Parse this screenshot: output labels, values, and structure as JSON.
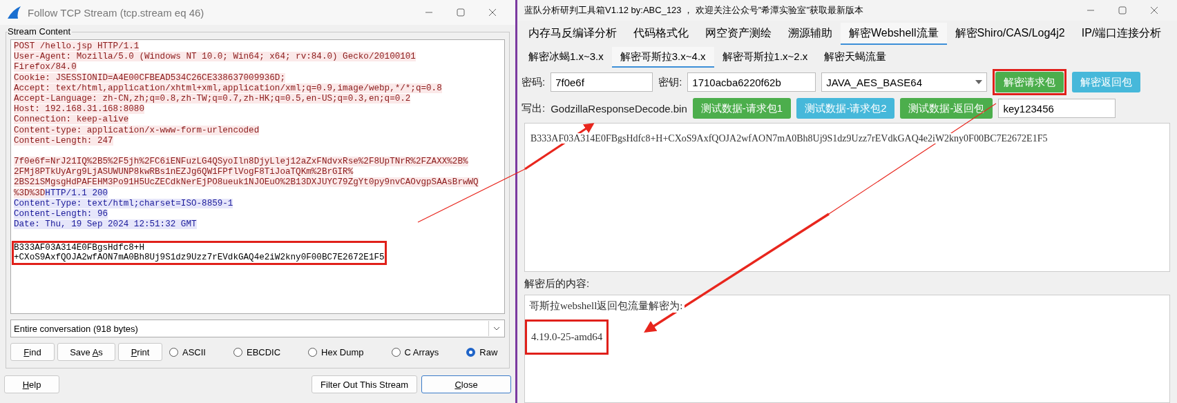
{
  "left_window": {
    "title": "Follow TCP Stream (tcp.stream eq 46)",
    "group_label": "Stream Content",
    "stream_lines": [
      {
        "kind": "client",
        "text": "POST /hello.jsp HTTP/1.1"
      },
      {
        "kind": "client",
        "text": "User-Agent: Mozilla/5.0 (Windows NT 10.0; Win64; x64; rv:84.0) Gecko/20100101"
      },
      {
        "kind": "client",
        "text": "Firefox/84.0"
      },
      {
        "kind": "client",
        "text": "Cookie: JSESSIONID=A4E00CFBEAD534C26CE338637009936D;"
      },
      {
        "kind": "client",
        "text": "Accept: text/html,application/xhtml+xml,application/xml;q=0.9,image/webp,*/*;q=0.8"
      },
      {
        "kind": "client",
        "text": "Accept-Language: zh-CN,zh;q=0.8,zh-TW;q=0.7,zh-HK;q=0.5,en-US;q=0.3,en;q=0.2"
      },
      {
        "kind": "client",
        "text": "Host: 192.168.31.168:8080"
      },
      {
        "kind": "client",
        "text": "Connection: keep-alive"
      },
      {
        "kind": "client",
        "text": "Content-type: application/x-www-form-urlencoded"
      },
      {
        "kind": "client",
        "text": "Content-Length: 247"
      },
      {
        "kind": "blank"
      },
      {
        "kind": "client",
        "text": "7f0e6f=NrJ21IQ%2B5%2F5jh%2FC6iENFuzLG4QSyoIln8DjyLlej12aZxFNdvxRse%2F8UpTNrR%2FZAXX%2B%"
      },
      {
        "kind": "client",
        "text": "2FMj8PTkUyArg9LjASUWUNP8kwRBs1nEZJg6QW1FPflVogF8TiJoaTQKm%2BrGIR%"
      },
      {
        "kind": "client",
        "text": "2BS2iSMgsgHdPAFEHM3Po91H5UcZECdkNerEjPO8ueuk1NJOEuO%2B13DXJUYC79ZgYt0py9nvCAOvgpSAAsBrwWQ"
      },
      {
        "kind": "mixed",
        "segments": [
          {
            "kind": "client",
            "text": "%3D%3D"
          },
          {
            "kind": "server",
            "text": "HTTP/1.1 200"
          }
        ]
      },
      {
        "kind": "server",
        "text": "Content-Type: text/html;charset=ISO-8859-1"
      },
      {
        "kind": "server",
        "text": "Content-Length: 96"
      },
      {
        "kind": "server",
        "text": "Date: Thu, 19 Sep 2024 12:51:32 GMT"
      },
      {
        "kind": "blank"
      }
    ],
    "response_body": [
      "B333AF03A314E0FBgsHdfc8+H",
      "+CXoS9AxfQOJA2wfAON7mA0Bh8Uj9S1dz9Uzz7rEVdkGAQ4e2iW2kny0F00BC7E2672E1F5"
    ],
    "conversation_select": "Entire conversation (918 bytes)",
    "buttons": [
      {
        "segments": [
          {
            "text": "F",
            "underlined": true
          },
          {
            "text": "ind",
            "underlined": false
          }
        ]
      },
      {
        "segments": [
          {
            "text": "Save ",
            "underlined": false
          },
          {
            "text": "A",
            "underlined": true
          },
          {
            "text": "s",
            "underlined": false
          }
        ]
      },
      {
        "segments": [
          {
            "text": "P",
            "underlined": true
          },
          {
            "text": "rint",
            "underlined": false
          }
        ]
      }
    ],
    "formats": [
      {
        "label": "ASCII",
        "selected": false
      },
      {
        "label": "EBCDIC",
        "selected": false
      },
      {
        "label": "Hex Dump",
        "selected": false
      },
      {
        "label": "C Arrays",
        "selected": false
      },
      {
        "label": "Raw",
        "selected": true
      }
    ],
    "footer_buttons": [
      {
        "segments": [
          {
            "text": "H",
            "underlined": true
          },
          {
            "text": "elp",
            "underlined": false
          }
        ],
        "default": false
      },
      {
        "segments": [
          {
            "text": "Filter Out This Stream",
            "underlined": false
          }
        ],
        "default": false
      },
      {
        "segments": [
          {
            "text": "C",
            "underlined": true
          },
          {
            "text": "lose",
            "underlined": false
          }
        ],
        "default": true
      }
    ]
  },
  "right_window": {
    "title": "蓝队分析研判工具箱V1.12 by:ABC_123 ， 欢迎关注公众号\"希潭实验室\"获取最新版本",
    "tabs": [
      {
        "label": "内存马反编译分析",
        "selected": false
      },
      {
        "label": "代码格式化",
        "selected": false
      },
      {
        "label": "网空资产测绘",
        "selected": false
      },
      {
        "label": "溯源辅助",
        "selected": false
      },
      {
        "label": "解密Webshell流量",
        "selected": true
      },
      {
        "label": "解密Shiro/CAS/Log4j2",
        "selected": false
      },
      {
        "label": "IP/端口连接分析",
        "selected": false
      }
    ],
    "subtabs": [
      {
        "label": "解密冰蝎1.x~3.x",
        "selected": false
      },
      {
        "label": "解密哥斯拉3.x~4.x",
        "selected": true
      },
      {
        "label": "解密哥斯拉1.x~2.x",
        "selected": false
      },
      {
        "label": "解密天蝎流量",
        "selected": false
      }
    ],
    "password_label": "密码:",
    "password": "7f0e6f",
    "key_label": "密钥:",
    "key": "1710acba6220f62b",
    "algorithm": "JAVA_AES_BASE64",
    "decrypt_buttons": [
      {
        "label": "解密请求包",
        "color": "#4cae4c",
        "framed": true
      },
      {
        "label": "解密返回包",
        "color": "#46b8da",
        "framed": false
      }
    ],
    "output_label": "写出:",
    "output_file": "GodzillaResponseDecode.bin",
    "test_buttons": [
      {
        "label": "测试数据-请求包1",
        "color": "#4cae4c"
      },
      {
        "label": "测试数据-请求包2",
        "color": "#46b8da"
      },
      {
        "label": "测试数据-返回包",
        "color": "#4cae4c"
      }
    ],
    "test_key": "key123456",
    "input_text": "B333AF03A314E0FBgsHdfc8+H+CXoS9AxfQOJA2wfAON7mA0Bh8Uj9S1dz9Uzz7rEVdkGAQ4e2iW2kny0F00BC7E2672E1F5",
    "result_label": "解密后的内容:",
    "result_heading": "哥斯拉webshell返回包流量解密为:",
    "result_value": "4.19.0-25-amd64"
  }
}
